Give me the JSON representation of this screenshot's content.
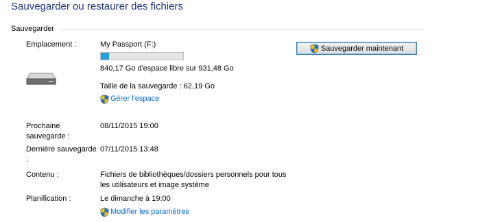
{
  "page": {
    "title": "Sauvegarder ou restaurer des fichiers"
  },
  "backup": {
    "section_label": "Sauvegarder",
    "location_label": "Emplacement :",
    "location_value": "My Passport (F:)",
    "disk_used_fraction": 0.098,
    "free_space": "840,17 Go d'espace libre sur 931,48 Go",
    "backup_size": "Taille de la sauvegarde : 62,19 Go",
    "manage_space_link": "Gérer l'espace",
    "backup_now_button": "Sauvegarder maintenant",
    "next_backup_label": "Prochaine sauvegarde :",
    "next_backup_value": "08/11/2015 19:00",
    "last_backup_label": "Dernière sauvegarde :",
    "last_backup_value": "07/11/2015 13:48",
    "contents_label": "Contenu :",
    "contents_value": "Fichiers de bibliothèques/dossiers personnels pour tous les utilisateurs et image système",
    "schedule_label": "Planification :",
    "schedule_value": "Le dimanche à 19:00",
    "change_settings_link": "Modifier les paramètres"
  },
  "colors": {
    "title": "#1e3287",
    "link": "#0066cc",
    "progress_fill": "#26a0da"
  },
  "icons": [
    "drive-icon",
    "shield-icon"
  ]
}
